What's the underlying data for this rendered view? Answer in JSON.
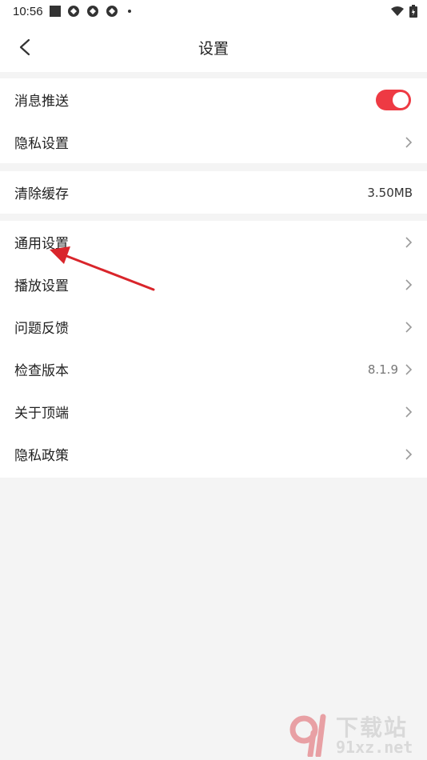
{
  "status_bar": {
    "time": "10:56",
    "icons": [
      "square-icon",
      "app-icon",
      "app-icon",
      "app-icon",
      "dot-icon",
      "wifi-icon",
      "battery-icon"
    ]
  },
  "nav": {
    "title": "设置",
    "back_icon": "back-arrow-icon"
  },
  "groups": [
    {
      "items": [
        {
          "label": "消息推送",
          "control": "toggle",
          "toggle_on": true,
          "toggle_color": "#ee3a43"
        },
        {
          "label": "隐私设置",
          "control": "chevron"
        }
      ]
    },
    {
      "items": [
        {
          "label": "清除缓存",
          "value": "3.50MB"
        }
      ]
    },
    {
      "items": [
        {
          "label": "通用设置",
          "control": "chevron"
        },
        {
          "label": "播放设置",
          "control": "chevron"
        },
        {
          "label": "问题反馈",
          "control": "chevron"
        },
        {
          "label": "检查版本",
          "value": "8.1.9",
          "control": "chevron"
        },
        {
          "label": "关于顶端",
          "control": "chevron"
        },
        {
          "label": "隐私政策",
          "control": "chevron"
        }
      ]
    }
  ],
  "annotation": {
    "icon": "red-arrow-icon",
    "color": "#d9252b"
  },
  "watermark": {
    "title": "下载站",
    "subtitle": "91xz.net",
    "logo_icon": "91-logo-icon",
    "logo_color": "#e0424a"
  }
}
